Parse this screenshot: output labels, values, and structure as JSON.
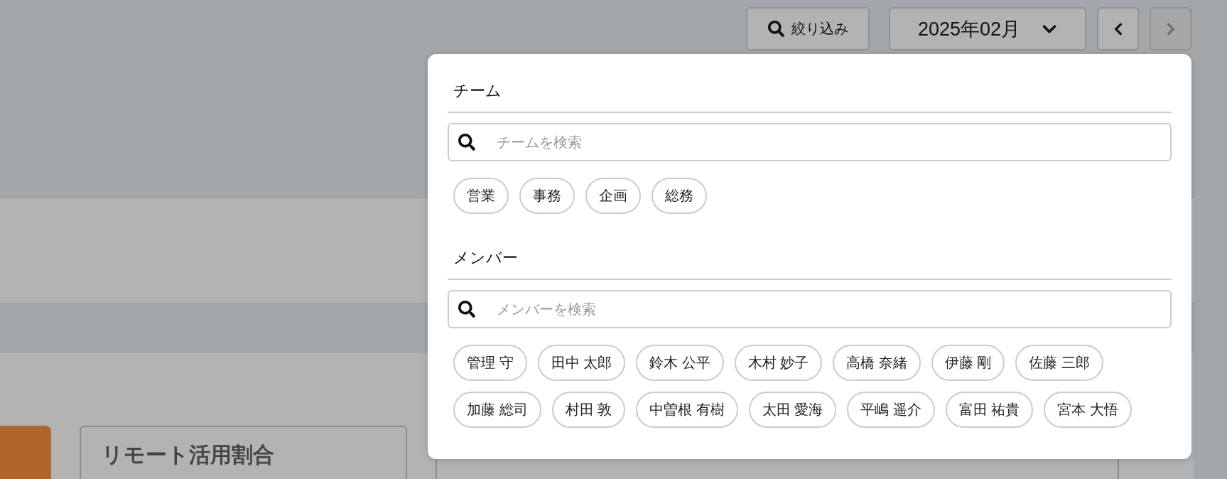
{
  "toolbar": {
    "filter_button": {
      "label": "絞り込み"
    },
    "month_select": {
      "value": "2025年02月"
    },
    "prev_button": {
      "disabled": false
    },
    "next_button": {
      "disabled": true
    }
  },
  "filter_popover": {
    "sections": [
      {
        "title": "チーム",
        "search": {
          "placeholder": "チームを検索"
        },
        "chips": [
          {
            "label": "営業",
            "selected": false
          },
          {
            "label": "事務",
            "selected": false
          },
          {
            "label": "企画",
            "selected": false
          },
          {
            "label": "総務",
            "selected": false
          }
        ]
      },
      {
        "title": "メンバー",
        "search": {
          "placeholder": "メンバーを検索"
        },
        "chips": [
          {
            "label": "管理 守",
            "selected": false
          },
          {
            "label": "田中 太郎",
            "selected": false
          },
          {
            "label": "鈴木 公平",
            "selected": false
          },
          {
            "label": "木村 妙子",
            "selected": false
          },
          {
            "label": "高橋 奈緒",
            "selected": false
          },
          {
            "label": "伊藤 剛",
            "selected": false
          },
          {
            "label": "佐藤 三郎",
            "selected": false
          },
          {
            "label": "加藤 総司",
            "selected": false
          },
          {
            "label": "村田 敦",
            "selected": false
          },
          {
            "label": "中曽根 有樹",
            "selected": false
          },
          {
            "label": "太田 愛海",
            "selected": false
          },
          {
            "label": "平嶋 遥介",
            "selected": false
          },
          {
            "label": "富田 祐貴",
            "selected": false
          },
          {
            "label": "宮本 大悟",
            "selected": false
          }
        ]
      }
    ]
  },
  "cards": [
    {
      "title": "リモート活用割合"
    }
  ]
}
